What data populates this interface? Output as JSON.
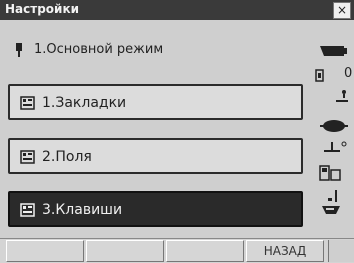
{
  "window": {
    "title": "Настройки",
    "close_label": "×"
  },
  "mode": {
    "text": "1.Основной режим",
    "icon": "pin-icon"
  },
  "menu": {
    "items": [
      {
        "label": "1.Закладки",
        "icon": "settings-book-icon",
        "selected": false
      },
      {
        "label": "2.Поля",
        "icon": "settings-book-icon",
        "selected": false
      },
      {
        "label": "3.Клавиши",
        "icon": "settings-book-icon",
        "selected": true
      }
    ]
  },
  "status": {
    "battery_icon": "battery-icon",
    "lock_icons": "lock-indicators",
    "tilt_value": "0",
    "target_icon": "target-icon",
    "level_icon": "level-icon",
    "mode_icon": "mode-icon",
    "signal_icon": "signal-icon"
  },
  "softkeys": [
    "",
    "",
    "",
    "НАЗАД"
  ]
}
